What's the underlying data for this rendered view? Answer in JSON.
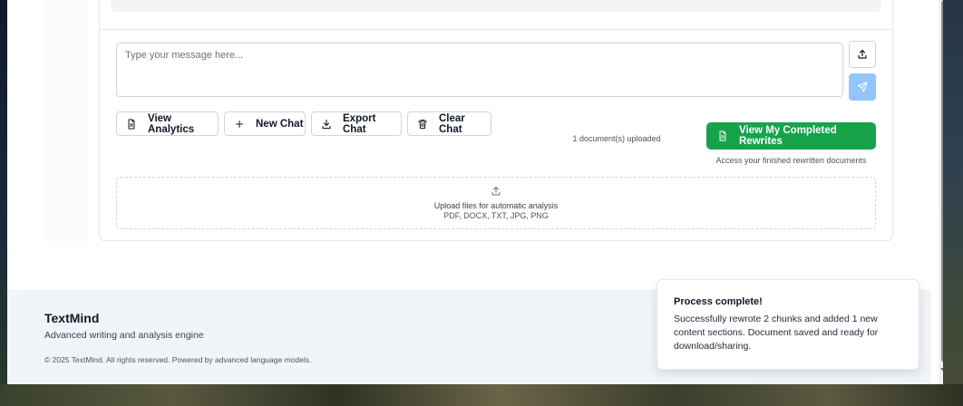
{
  "composer": {
    "placeholder": "Type your message here..."
  },
  "actions": {
    "analytics_label": "View Analytics",
    "new_chat_label": "New Chat",
    "export_label": "Export Chat",
    "clear_label": "Clear Chat"
  },
  "status": {
    "documents_uploaded": "1 document(s) uploaded"
  },
  "rewrites": {
    "button_label": "View My Completed Rewrites",
    "caption": "Access your finished rewritten documents",
    "accent_color": "#16a34a"
  },
  "dropzone": {
    "title": "Upload files for automatic analysis",
    "types": "PDF, DOCX, TXT, JPG, PNG"
  },
  "footer": {
    "brand": "TextMind",
    "tagline": "Advanced writing and analysis engine",
    "copyright": "© 2025 TextMind. All rights reserved. Powered by advanced language models."
  },
  "toast": {
    "title": "Process complete!",
    "message": "Successfully rewrote 2 chunks and added 1 new content sections. Document saved and ready for download/sharing."
  },
  "icons": {
    "upload": "upload-icon",
    "send": "send-icon",
    "analytics": "document-icon",
    "new_chat": "plus-icon",
    "export": "download-icon",
    "clear": "trash-icon",
    "rewrites": "document-icon"
  }
}
